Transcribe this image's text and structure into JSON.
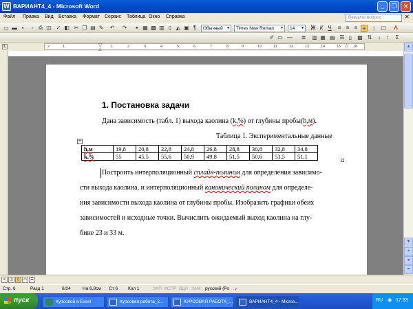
{
  "window": {
    "title": "ВАРИАНТ4_4 - Microsoft Word",
    "app_icon": "word-icon"
  },
  "menu": {
    "items": [
      "Файл",
      "Правка",
      "Вид",
      "Вставка",
      "Формат",
      "Сервис",
      "Таблица",
      "Окно",
      "Справка"
    ],
    "help_placeholder": "Введите вопрос"
  },
  "toolbar": {
    "style": "Обычный",
    "font": "Times New Roman",
    "size": "14"
  },
  "ruler": {
    "ticks": [
      "2",
      "1",
      "1",
      "2",
      "3",
      "4",
      "5",
      "6",
      "7",
      "8",
      "9",
      "10",
      "11",
      "12",
      "13",
      "14",
      "15",
      "16",
      "18"
    ]
  },
  "document": {
    "heading": "1. Постановка задачи",
    "intro_parts": [
      "Дана зависимость (табл. 1) выхода каолина (",
      "k,%",
      ") от глубины пробы(",
      "h,м",
      ")."
    ],
    "table_caption": "Таблица 1. Экспериментальные данные",
    "table": {
      "rows": [
        {
          "header": "h,м",
          "values": [
            "19,8",
            "20,8",
            "22,8",
            "24,8",
            "26,8",
            "28,8",
            "30,8",
            "32,8",
            "34,8"
          ]
        },
        {
          "header": "k,%",
          "values": [
            "55",
            "45,5",
            "55,6",
            "50,9",
            "49,8",
            "51,5",
            "50,6",
            "53,5",
            "51,1"
          ]
        }
      ]
    },
    "body_lines": [
      [
        "Построить интерполяционный ",
        "сплайн-полином",
        " для определения зависимо-"
      ],
      [
        "сти выхода каолина, и интерполяционный ",
        "канонический полином",
        "  для определе-"
      ],
      [
        "ния зависимости выхода каолина от глубины пробы. Изобразить графики обеих"
      ],
      [
        "зависимостей и исходные точки. Вычислить ожидаемый выход  каолина на глу-"
      ],
      [
        "бине 23 и 33 м."
      ]
    ]
  },
  "status": {
    "page": "Стр. 6",
    "section": "Разд 1",
    "pages": "6/24",
    "at": "На 6,8см",
    "line": "Ст 6",
    "col": "Кол 1",
    "rec": "ЗАП",
    "trk": "ИСПР",
    "ext": "ВДЛ",
    "ovr": "ЗАМ",
    "lang": "русский (Ро"
  },
  "taskbar": {
    "start": "пуск",
    "tasks": [
      "Курсовой в Excel",
      "Курсовая работа_2...",
      "КУРСОВАЯ РАБОТА_...",
      "ВАРИАНТ4_4 - Micros..."
    ],
    "lang": "RU",
    "time": "17:33"
  }
}
